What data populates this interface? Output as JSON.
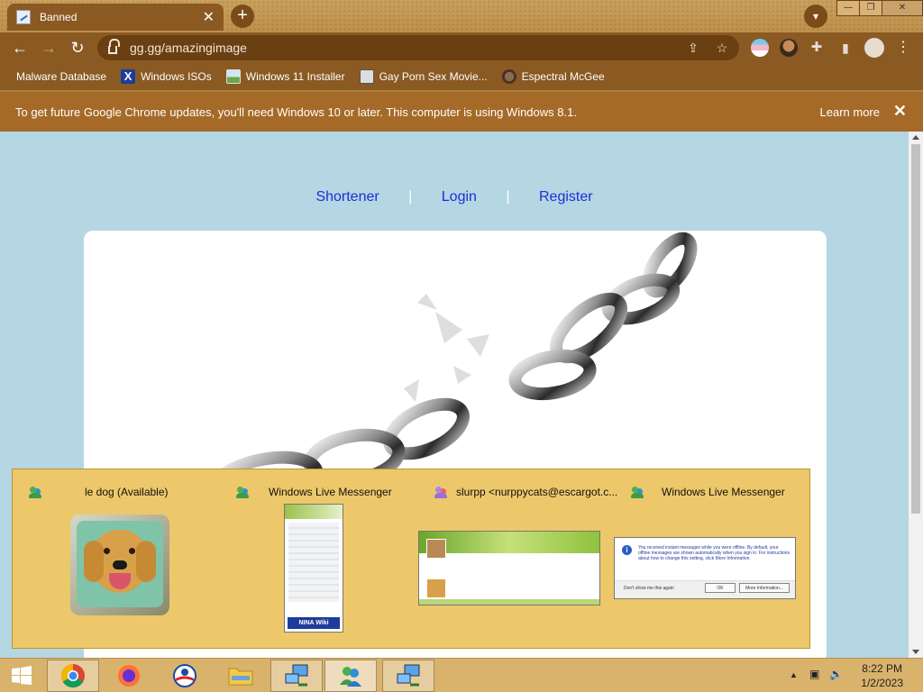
{
  "browser": {
    "tab_title": "Banned",
    "url": "gg.gg/amazingimage",
    "bookmarks": [
      {
        "label": "Malware Database",
        "icon": "folder-icon"
      },
      {
        "label": "Windows ISOs",
        "icon": "x-logo-icon"
      },
      {
        "label": "Windows 11 Installer",
        "icon": "image-icon"
      },
      {
        "label": "Gay Porn Sex Movie...",
        "icon": "site-icon"
      },
      {
        "label": "Espectral McGee",
        "icon": "cat-icon"
      }
    ],
    "infobar": {
      "message": "To get future Google Chrome updates, you'll need Windows 10 or later. This computer is using Windows 8.1.",
      "learn_more": "Learn more"
    }
  },
  "page": {
    "nav": {
      "shortener": "Shortener",
      "login": "Login",
      "register": "Register",
      "separator": "|"
    }
  },
  "thumbnails": [
    {
      "title": "le dog (Available)"
    },
    {
      "title": "Windows Live Messenger",
      "panel_footer": "NINA Wiki"
    },
    {
      "title": "slurpp <nurppycats@escargot.c..."
    },
    {
      "title": "Windows Live Messenger",
      "dialog_text": "You received instant messages while you were offline. By default, your offline messages are shown automatically when you sign in. For instructions about how to change this setting, click More Information.",
      "checkbox": "Don't show me this again",
      "ok": "OK",
      "more": "More Information..."
    }
  ],
  "taskbar": {
    "time": "8:22 PM",
    "date": "1/2/2023"
  },
  "colors": {
    "link": "#1b2fd6",
    "page_bg": "#b5d6e3",
    "thumb_bg": "#ecc86a",
    "taskbar": "#d9b26c"
  }
}
